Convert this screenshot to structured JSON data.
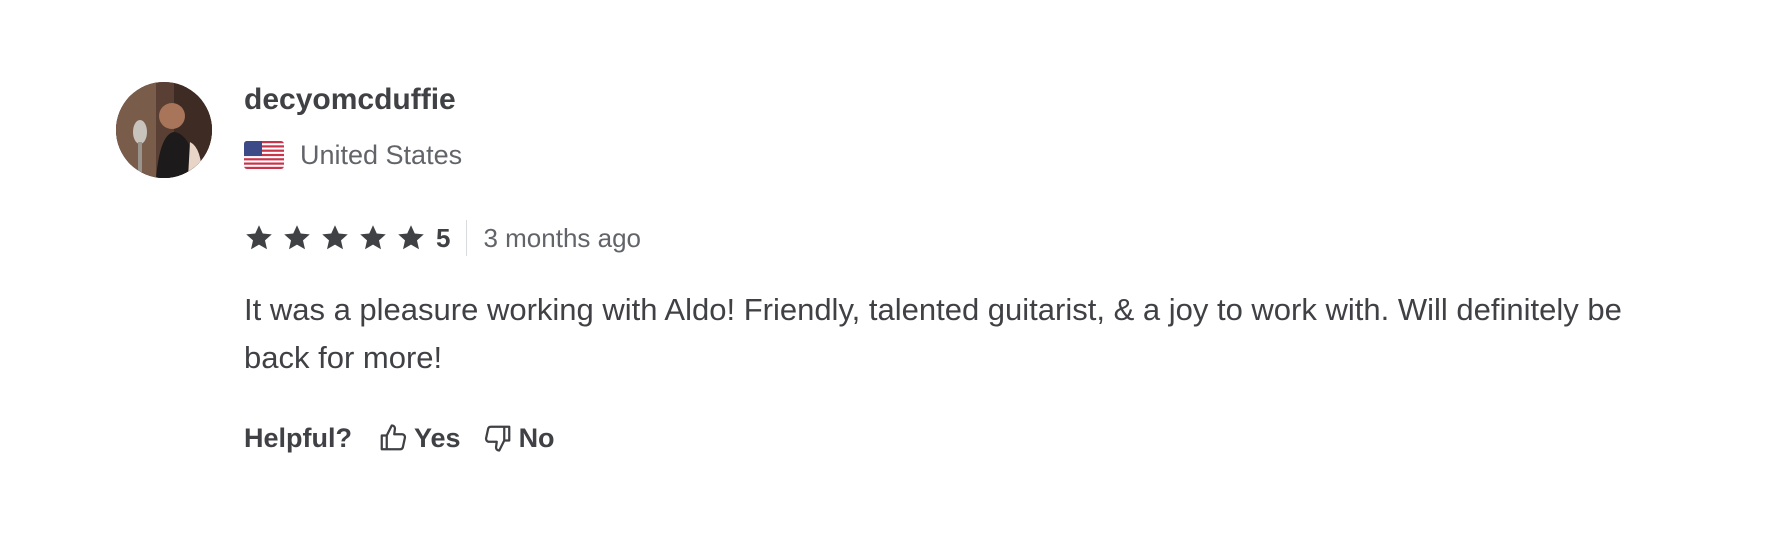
{
  "review": {
    "username": "decyomcduffie",
    "country": "United States",
    "flag_icon": "us-flag-icon",
    "rating": {
      "stars": 5,
      "score_label": "5",
      "star_color": "#404145"
    },
    "time_ago": "3 months ago",
    "text": "It was a pleasure working with Aldo! Friendly, talented guitarist, & a joy to work with. Will definitely be back for more!",
    "helpful": {
      "label": "Helpful?",
      "yes_label": "Yes",
      "no_label": "No"
    }
  }
}
